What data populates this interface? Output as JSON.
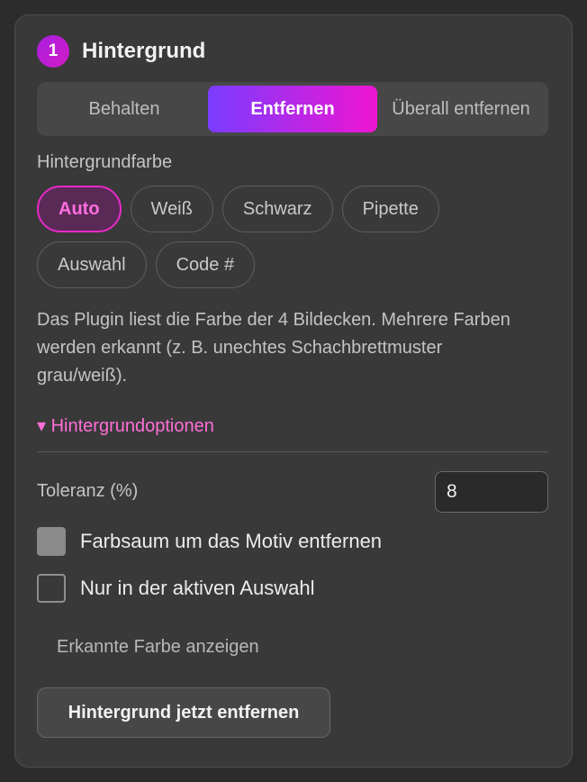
{
  "section": {
    "step_number": "1",
    "title": "Hintergrund"
  },
  "mode": {
    "options": [
      "Behalten",
      "Entfernen",
      "Überall entfernen"
    ],
    "selected": "Entfernen"
  },
  "background_color": {
    "label": "Hintergrundfarbe",
    "chips_row1": [
      "Auto",
      "Weiß",
      "Schwarz",
      "Pipette"
    ],
    "chips_row2": [
      "Auswahl",
      "Code #"
    ],
    "selected": "Auto"
  },
  "description": "Das Plugin liest die Farbe der 4 Bildecken. Mehrere Farben werden erkannt (z. B. unechtes Schachbrettmuster grau/weiß).",
  "options": {
    "toggle_label": "▾ Hintergrundoptionen",
    "tolerance_label": "Toleranz (%)",
    "tolerance_value": "8",
    "checkbox_fringe": {
      "label": "Farbsaum um das Motiv entfernen",
      "checked": true
    },
    "checkbox_selection": {
      "label": "Nur in der aktiven Auswahl",
      "checked": false
    },
    "show_color_label": "Erkannte Farbe anzeigen"
  },
  "action": {
    "label": "Hintergrund jetzt entfernen"
  },
  "colors": {
    "accent_start": "#7b3cff",
    "accent_end": "#ee15d1",
    "accent_text": "#ff6fd8",
    "panel_bg": "#393939"
  }
}
